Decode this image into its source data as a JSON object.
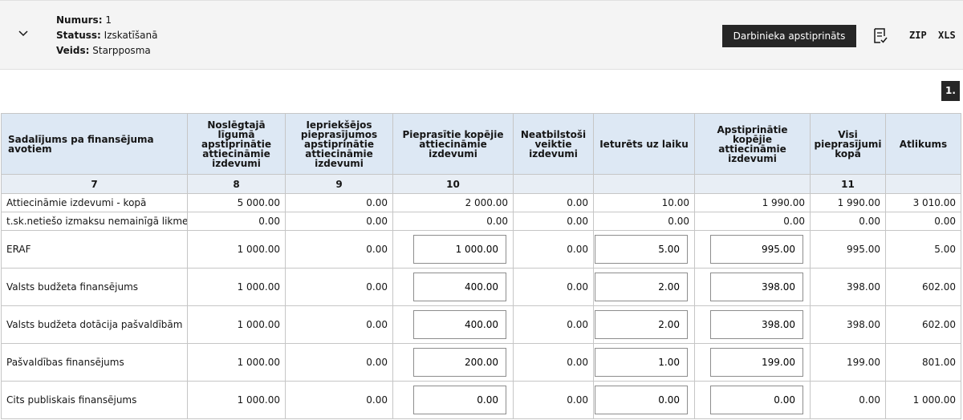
{
  "header": {
    "numurs_label": "Numurs:",
    "numurs_value": "1",
    "statuss_label": "Statuss:",
    "statuss_value": "Izskatīšanā",
    "veids_label": "Veids:",
    "veids_value": "Starpposma",
    "approve_button": "Darbinieka apstiprināts",
    "zip_label": "ZIP",
    "xls_label": "XLS"
  },
  "page_badge": "1.",
  "table": {
    "columns": [
      "Sadalījums pa finansējuma avotiem",
      "Noslēgtajā līgumā apstiprinātie attiecināmie izdevumi",
      "Iepriekšējos pieprasījumos apstiprinātie attiecināmie izdevumi",
      "Pieprasītie kopējie attiecināmie izdevumi",
      "Neatbilstoši veiktie izdevumi",
      "Ieturēts uz laiku",
      "Apstiprinātie kopējie attiecināmie izdevumi",
      "Visi pieprasījumi kopā",
      "Atlikums"
    ],
    "column_numbers": [
      "7",
      "8",
      "9",
      "10",
      "",
      "",
      "",
      "11",
      ""
    ],
    "rows": [
      [
        "Attiecināmie izdevumi - kopā",
        "5 000.00",
        "0.00",
        "2 000.00",
        "0.00",
        "10.00",
        "1 990.00",
        "1 990.00",
        "3 010.00"
      ],
      [
        "t.sk.netiešo izmaksu nemainīgā likme",
        "0.00",
        "0.00",
        "0.00",
        "0.00",
        "0.00",
        "0.00",
        "0.00",
        "0.00"
      ],
      [
        "ERAF",
        "1 000.00",
        "0.00",
        "1 000.00",
        "0.00",
        "5.00",
        "995.00",
        "995.00",
        "5.00"
      ],
      [
        "Valsts budžeta finansējums",
        "1 000.00",
        "0.00",
        "400.00",
        "0.00",
        "2.00",
        "398.00",
        "398.00",
        "602.00"
      ],
      [
        "Valsts budžeta dotācija pašvaldībām",
        "1 000.00",
        "0.00",
        "400.00",
        "0.00",
        "2.00",
        "398.00",
        "398.00",
        "602.00"
      ],
      [
        "Pašvaldības finansējums",
        "1 000.00",
        "0.00",
        "200.00",
        "0.00",
        "1.00",
        "199.00",
        "199.00",
        "801.00"
      ],
      [
        "Cits publiskais finansējums",
        "1 000.00",
        "0.00",
        "0.00",
        "0.00",
        "0.00",
        "0.00",
        "0.00",
        "1 000.00"
      ]
    ]
  },
  "icons": {
    "chevron": "chevron-down-icon",
    "document": "document-check-icon"
  }
}
